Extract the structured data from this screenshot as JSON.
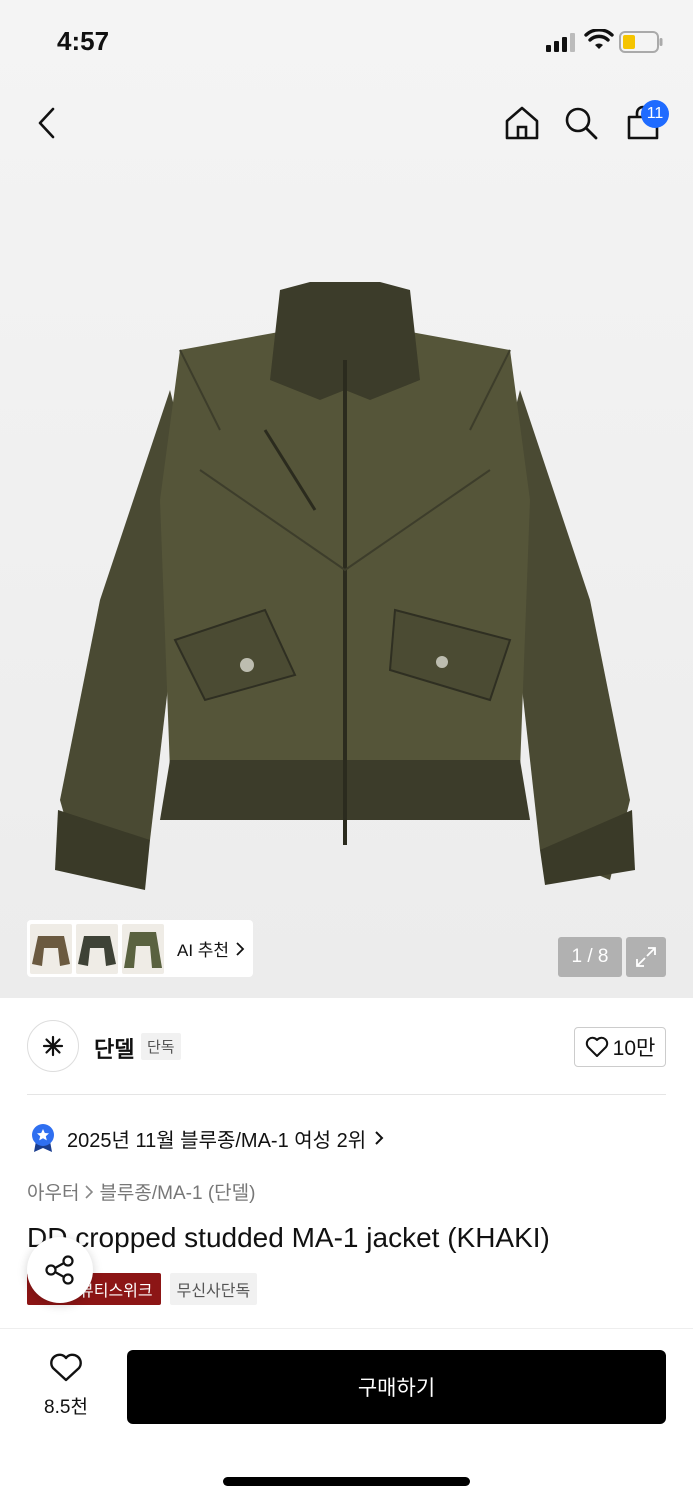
{
  "status_bar": {
    "time": "4:57"
  },
  "nav": {
    "cart_count": "11"
  },
  "gallery": {
    "ai_label": "AI 추천",
    "counter": "1 / 8",
    "thumb_colors": [
      "#6b5a40",
      "#3e4236",
      "#5a6240"
    ]
  },
  "brand": {
    "name": "단델",
    "tag": "단독",
    "likes": "10만"
  },
  "ranking": {
    "text": "2025년 11월 블루종/MA-1 여성 2위"
  },
  "breadcrumb": {
    "items": [
      "아우터",
      "블루종/MA-1 (단델)"
    ]
  },
  "product": {
    "title": "DD cropped studded MA-1 jacket (KHAKI)",
    "tags": [
      "뷰티스위크",
      "무신사단독"
    ]
  },
  "bottom": {
    "wish_count": "8.5천",
    "buy_label": "구매하기"
  },
  "colors": {
    "accent": "#1f6bff",
    "tag_red": "#8c1515",
    "jacket": "#4a4a33"
  }
}
